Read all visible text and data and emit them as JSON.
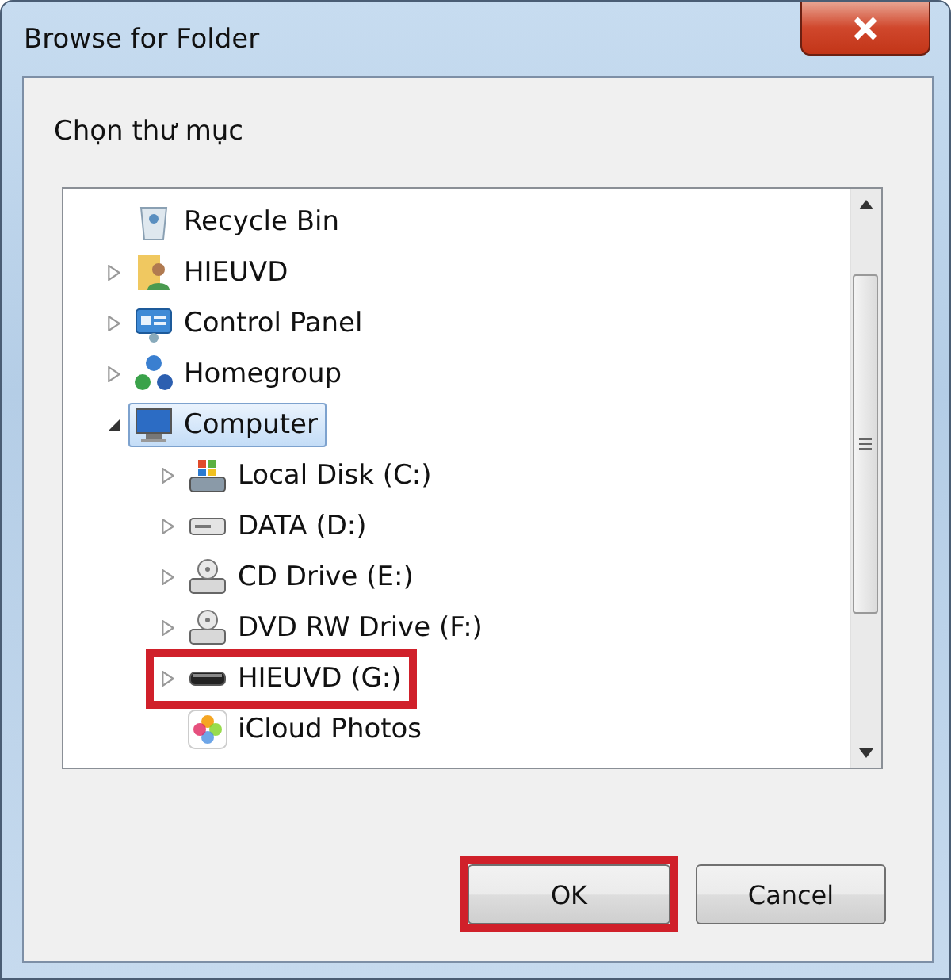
{
  "window": {
    "title": "Browse for Folder"
  },
  "prompt": "Chọn thư mục",
  "tree": [
    {
      "label": "Recycle Bin",
      "kind": "recycle",
      "expandable": false,
      "expanded": false,
      "selected": false,
      "highlighted": false
    },
    {
      "label": "HIEUVD",
      "kind": "user",
      "expandable": true,
      "expanded": false,
      "selected": false,
      "highlighted": false
    },
    {
      "label": "Control Panel",
      "kind": "control",
      "expandable": true,
      "expanded": false,
      "selected": false,
      "highlighted": false
    },
    {
      "label": "Homegroup",
      "kind": "homegroup",
      "expandable": true,
      "expanded": false,
      "selected": false,
      "highlighted": false
    },
    {
      "label": "Computer",
      "kind": "computer",
      "expandable": true,
      "expanded": true,
      "selected": true,
      "highlighted": false,
      "children": [
        {
          "label": "Local Disk (C:)",
          "kind": "system-disk",
          "expandable": true,
          "expanded": false,
          "selected": false,
          "highlighted": false
        },
        {
          "label": "DATA (D:)",
          "kind": "disk",
          "expandable": true,
          "expanded": false,
          "selected": false,
          "highlighted": false
        },
        {
          "label": "CD Drive (E:)",
          "kind": "cd",
          "expandable": true,
          "expanded": false,
          "selected": false,
          "highlighted": false
        },
        {
          "label": "DVD RW Drive (F:)",
          "kind": "cd",
          "expandable": true,
          "expanded": false,
          "selected": false,
          "highlighted": false
        },
        {
          "label": "HIEUVD (G:)",
          "kind": "removable",
          "expandable": true,
          "expanded": false,
          "selected": false,
          "highlighted": true
        },
        {
          "label": "iCloud Photos",
          "kind": "photos",
          "expandable": false,
          "expanded": false,
          "selected": false,
          "highlighted": false
        }
      ]
    }
  ],
  "buttons": [
    {
      "label": "OK",
      "highlighted": true
    },
    {
      "label": "Cancel",
      "highlighted": false
    }
  ]
}
